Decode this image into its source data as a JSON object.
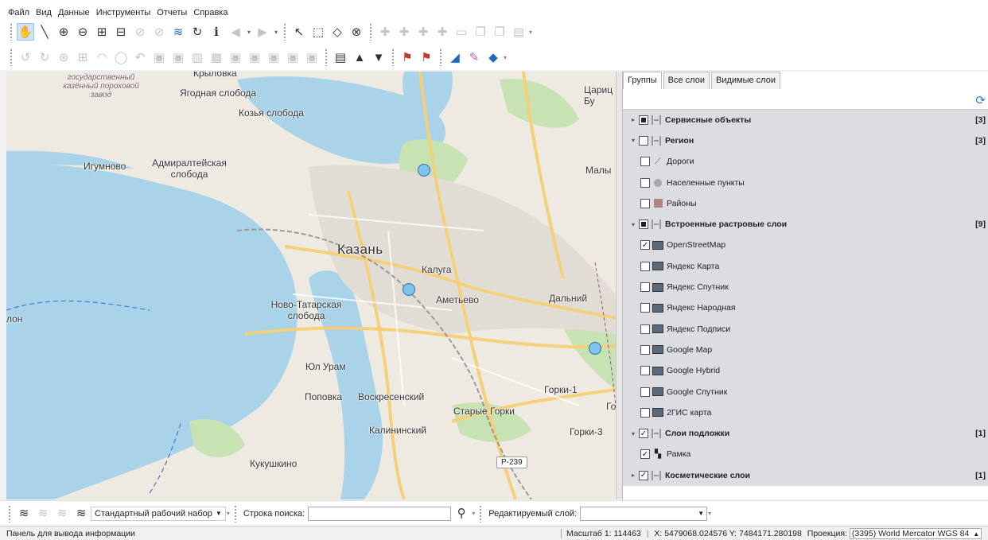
{
  "menu": [
    "Файл",
    "Вид",
    "Данные",
    "Инструменты",
    "Отчеты",
    "Справка"
  ],
  "toolbar1_icons": [
    "hand-icon",
    "ruler-icon",
    "zoom-in-icon",
    "zoom-out-icon",
    "zoom-rect-icon",
    "zoom-out-rect-icon",
    "zoom-prev-icon",
    "zoom-next-icon",
    "layers-icon",
    "refresh-map-icon",
    "info-icon",
    "back-icon",
    "forward-icon",
    "select-arrow-icon",
    "select-rect-icon",
    "select-polygon-icon",
    "clear-selection-icon",
    "add-point-icon",
    "add-line-icon",
    "add-polygon-icon",
    "add-node-icon",
    "copy-icon",
    "paste-icon",
    "edit-attributes-icon"
  ],
  "toolbar2_icons": [
    "rotate-left-icon",
    "rotate-right-icon",
    "merge-icon",
    "split-icon",
    "arc-icon",
    "circle-icon",
    "undo-icon",
    "grid1-icon",
    "grid2-icon",
    "grid3-icon",
    "grid4-icon",
    "grid5-icon",
    "grid6-icon",
    "grid7-icon",
    "grid8-icon",
    "grid9-icon",
    "table-icon",
    "up-icon",
    "down-icon",
    "flag-add-icon",
    "flag-remove-icon",
    "paint-icon",
    "style-icon",
    "fill-icon"
  ],
  "map": {
    "labels": {
      "gos_zavod": "государственный казённый пороховой завод",
      "krylovka": "Крыловка",
      "yagodnaya": "Ягодная слобода",
      "kozya": "Козья слобода",
      "igumnovo": "Игумново",
      "admiralteiskaya": "Адмиралтейская слобода",
      "caric": "Цариц Бу",
      "maly": "Малы",
      "kazan": "Казань",
      "kaluga": "Калуга",
      "ametevo": "Аметьево",
      "dalny": "Дальний",
      "novo_tatarskaya": "Ново-Татарская слобода",
      "lon": "лон",
      "yul_uram": "Юл Урам",
      "gorki1": "Горки-1",
      "go": "Го",
      "poprovka": "Поповка",
      "voskresensky": "Воскресенский",
      "starye_gorki": "Старые Горки",
      "kalininsky": "Калининский",
      "gorki3": "Горки-3",
      "kukushkino": "Кукушкино",
      "road_sign": "Р-239"
    },
    "colors": {
      "water": "#a9d3e8",
      "land": "#eee9e1",
      "green": "#c7e2b3",
      "road": "#f9d88c",
      "marker": "#7ec3ee"
    }
  },
  "panel": {
    "tabs": [
      "Группы",
      "Все слои",
      "Видимые слои"
    ],
    "rows": [
      {
        "type": "group",
        "expander": "▸",
        "check": "partial",
        "icon": "group",
        "label": "Сервисные объекты",
        "count": "[3]"
      },
      {
        "type": "group",
        "expander": "▾",
        "check": "unchecked",
        "icon": "group",
        "label": "Регион",
        "count": "[3]"
      },
      {
        "type": "item",
        "check": "unchecked",
        "icon": "road",
        "label": "Дороги"
      },
      {
        "type": "item",
        "check": "unchecked",
        "icon": "point",
        "label": "Населенные пункты"
      },
      {
        "type": "item",
        "check": "unchecked",
        "icon": "area",
        "label": "Районы"
      },
      {
        "type": "group",
        "expander": "▾",
        "check": "partial",
        "icon": "group",
        "label": "Встроенные растровые слои",
        "count": "[9]"
      },
      {
        "type": "item",
        "check": "checked",
        "icon": "raster",
        "label": "OpenStreetMap"
      },
      {
        "type": "item",
        "check": "unchecked",
        "icon": "raster",
        "label": "Яндекс Карта"
      },
      {
        "type": "item",
        "check": "unchecked",
        "icon": "raster",
        "label": "Яндекс Спутник"
      },
      {
        "type": "item",
        "check": "unchecked",
        "icon": "raster",
        "label": "Яндекс Народная"
      },
      {
        "type": "item",
        "check": "unchecked",
        "icon": "raster",
        "label": "Яндекс Подписи"
      },
      {
        "type": "item",
        "check": "unchecked",
        "icon": "raster",
        "label": "Google Map"
      },
      {
        "type": "item",
        "check": "unchecked",
        "icon": "raster",
        "label": "Google Hybrid"
      },
      {
        "type": "item",
        "check": "unchecked",
        "icon": "raster",
        "label": "Google Спутник"
      },
      {
        "type": "item",
        "check": "unchecked",
        "icon": "raster",
        "label": "2ГИС карта"
      },
      {
        "type": "group",
        "expander": "▾",
        "check": "checked",
        "icon": "group",
        "label": "Слои подложки",
        "count": "[1]"
      },
      {
        "type": "item",
        "check": "checked",
        "icon": "frame",
        "label": "Рамка"
      },
      {
        "type": "group",
        "expander": "▸",
        "check": "checked",
        "icon": "group",
        "label": "Косметические слои",
        "count": "[1]"
      }
    ]
  },
  "bottom": {
    "workset": "Стандартный рабочий набор",
    "search_label": "Строка поиска:",
    "search_value": "",
    "edit_layer_label": "Редактируемый слой:",
    "edit_layer_value": ""
  },
  "status": {
    "left": "Панель для вывода информации",
    "scale": "Масштаб 1: 114463",
    "coords": "X: 5479068.024576  Y: 7484171.280198",
    "proj_label": "Проекция:",
    "proj_value": "(3395) World Mercator WGS 84"
  }
}
